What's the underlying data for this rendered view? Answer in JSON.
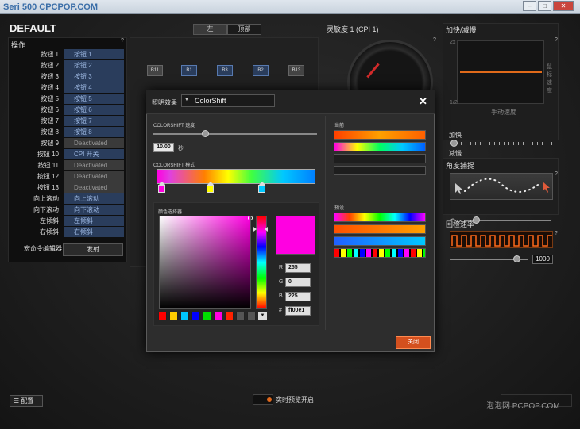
{
  "window": {
    "watermark_top": "Seri 500 CPCPOP.COM",
    "minimize": "–",
    "maximize": "□",
    "close": "✕"
  },
  "profile": {
    "title": "DEFAULT"
  },
  "buttons_panel": {
    "header": "操作",
    "help": "?",
    "rows": [
      {
        "label": "按钮 1",
        "value": "按钮 1",
        "state": "active"
      },
      {
        "label": "按钮 2",
        "value": "按钮 2",
        "state": "active"
      },
      {
        "label": "按钮 3",
        "value": "按钮 3",
        "state": "active"
      },
      {
        "label": "按钮 4",
        "value": "按钮 4",
        "state": "active"
      },
      {
        "label": "按钮 5",
        "value": "按钮 5",
        "state": "active"
      },
      {
        "label": "按钮 6",
        "value": "按钮 6",
        "state": "active"
      },
      {
        "label": "按钮 7",
        "value": "按钮 7",
        "state": "active"
      },
      {
        "label": "按钮 8",
        "value": "按钮 8",
        "state": "active"
      },
      {
        "label": "按钮 9",
        "value": "Deactivated",
        "state": "deactivated"
      },
      {
        "label": "按钮 10",
        "value": "CPI 开关",
        "state": "active"
      },
      {
        "label": "按钮 11",
        "value": "Deactivated",
        "state": "deactivated"
      },
      {
        "label": "按钮 12",
        "value": "Deactivated",
        "state": "deactivated"
      },
      {
        "label": "按钮 13",
        "value": "Deactivated",
        "state": "deactivated"
      },
      {
        "label": "向上滚动",
        "value": "向上滚动",
        "state": "active"
      },
      {
        "label": "向下滚动",
        "value": "向下滚动",
        "state": "active"
      },
      {
        "label": "左倾斜",
        "value": "左倾斜",
        "state": "active"
      },
      {
        "label": "右倾斜",
        "value": "右倾斜",
        "state": "active"
      }
    ],
    "macro_label": "宏命令编辑器",
    "fire_button": "发射"
  },
  "mouse_view": {
    "tabs": [
      "左",
      "顶部"
    ],
    "buttons": [
      "B11",
      "B1",
      "B3",
      "B2",
      "B13"
    ]
  },
  "sensitivity": {
    "title": "灵敏度 1 (CPI 1)",
    "help": "?"
  },
  "acceleration": {
    "title": "加快/减慢",
    "help": "?",
    "y_top": "2x",
    "y_bottom": "1/2",
    "vertical_label": "鼠标速度",
    "x_label": "手动速度",
    "accel_label": "加快",
    "decel_label": "减慢",
    "accel_level": 0.03,
    "decel_level": 0.03
  },
  "angle_snapping": {
    "title": "角度捕捉",
    "help": "?",
    "level": 0.13
  },
  "polling": {
    "title": "回检速率",
    "help": "?",
    "value": "1000",
    "level": 0.85
  },
  "bottom_bar": {
    "config_button": "配置",
    "realtime_preview": "实时预览开启",
    "watermark_bottom": "泡泡网 PCPOP.COM"
  },
  "lighting_modal": {
    "effect_label": "照明效果",
    "effect_value": "ColorShift",
    "close": "✕",
    "speed_label": "COLORSHIFT 速度",
    "speed_value": "10.00",
    "speed_unit": "秒",
    "speed_level": 0.32,
    "mode_label": "COLORSHIFT 模式",
    "picker_label": "颜色选择器",
    "rgb": {
      "r_label": "R",
      "r": "255",
      "g_label": "G",
      "g": "0",
      "b_label": "B",
      "b": "225",
      "hex_label": "#",
      "hex": "ff00e1"
    },
    "current_label": "当前",
    "preset_label": "预设",
    "ok_button": "关闭",
    "colors": {
      "accent": "#d4501e",
      "selected": "#ff00e1",
      "swatches": [
        "#ff0000",
        "#ffcc00",
        "#00c8ff",
        "#0000ff",
        "#00e000",
        "#ff00e1",
        "#ff2200",
        "#555555",
        "#555555"
      ],
      "gradient_stops": [
        "#ff00e1",
        "#ffff00",
        "#00c8ff"
      ],
      "current": [
        "linear-gradient(90deg,#ff4000,#ffa000,#ff6000)",
        "linear-gradient(90deg,#ff00e1,#ffff00,#00ff60,#00c8ff,#0060ff)",
        "#1e1e1e",
        "#1e1e1e"
      ],
      "presets": [
        "linear-gradient(90deg,#ff00ff,#ff4000,#ffff00,#00ff00,#00ffff,#0000ff,#ff00ff)",
        "linear-gradient(90deg,#ff5000,#ffa000)",
        "linear-gradient(90deg,#2060ff,#00c8ff)",
        "repeating-linear-gradient(90deg,#ff0000 0 6px,#000 6px 8px,#ffff00 8px 14px,#000 14px 16px,#00ff00 16px 22px,#000 22px 24px,#00ffff 24px 30px,#000 30px 32px,#0000ff 32px 38px,#000 38px 40px,#ff00ff 40px 46px,#000 46px 48px)"
      ]
    }
  }
}
